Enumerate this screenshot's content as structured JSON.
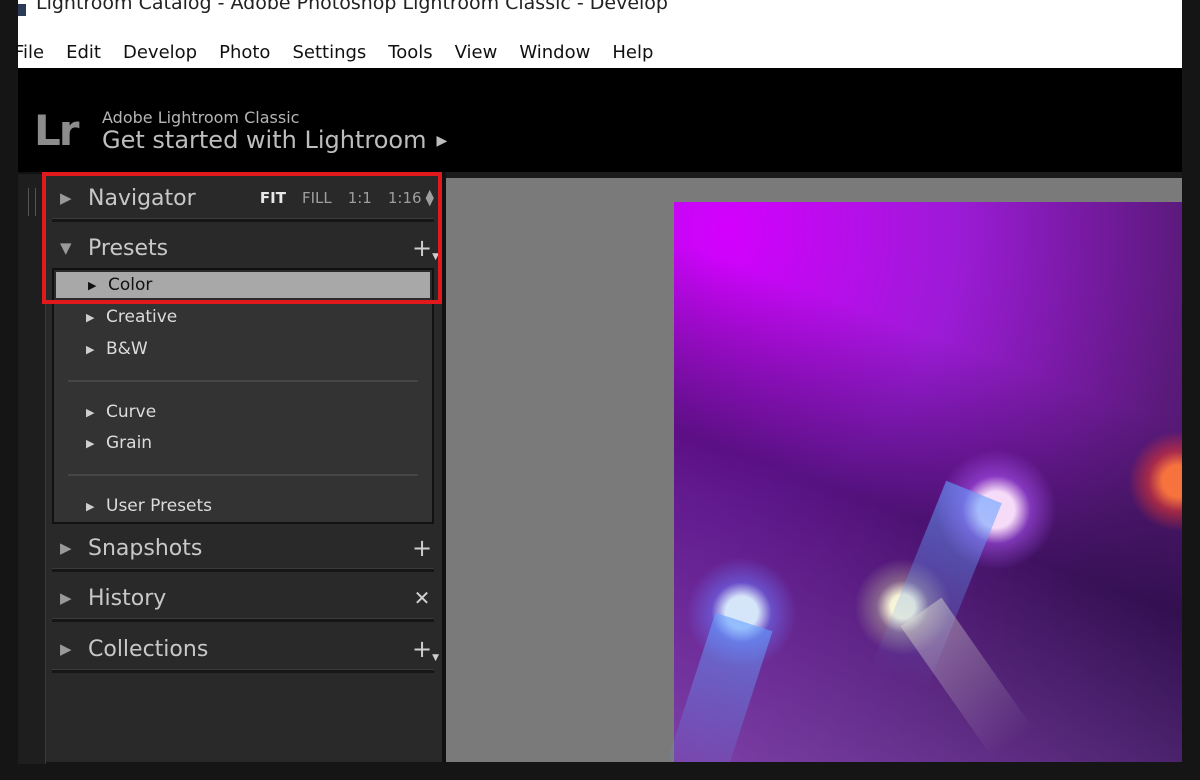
{
  "window": {
    "title": "Lightroom Catalog - Adobe Photoshop Lightroom Classic - Develop"
  },
  "menubar": {
    "items": [
      "File",
      "Edit",
      "Develop",
      "Photo",
      "Settings",
      "Tools",
      "View",
      "Window",
      "Help"
    ]
  },
  "identity": {
    "logo": "Lr",
    "brand": "Adobe Lightroom Classic",
    "get_started": "Get started with Lightroom",
    "arrow": "▶"
  },
  "panels": {
    "navigator": {
      "title": "Navigator",
      "zoom": [
        "FIT",
        "FILL",
        "1:1",
        "1:16"
      ],
      "active_zoom": "FIT"
    },
    "presets": {
      "title": "Presets",
      "groups": [
        {
          "label": "Color",
          "selected": true
        },
        {
          "label": "Creative"
        },
        {
          "label": "B&W"
        },
        {
          "label": "Curve"
        },
        {
          "label": "Grain"
        },
        {
          "label": "User Presets"
        }
      ]
    },
    "snapshots": {
      "title": "Snapshots"
    },
    "history": {
      "title": "History"
    },
    "collections": {
      "title": "Collections"
    }
  },
  "icons": {
    "collapsed": "▶",
    "expanded": "▼",
    "plus": "+",
    "close": "✕"
  },
  "colors": {
    "highlight": "#e0191d",
    "panel_bg": "#292929",
    "selected_row": "#a8a8a8"
  }
}
